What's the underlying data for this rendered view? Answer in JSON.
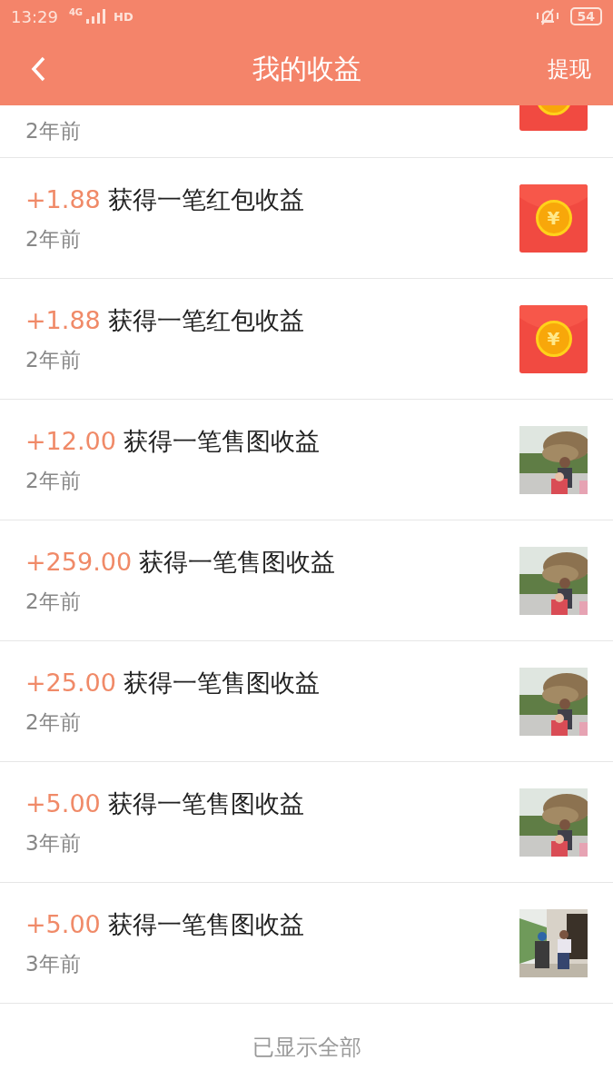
{
  "status_bar": {
    "time": "13:29",
    "network": "4G",
    "hd": "HD",
    "battery": "54"
  },
  "header": {
    "title": "我的收益",
    "action": "提现"
  },
  "items": [
    {
      "kind": "envelope",
      "partial": true,
      "time": "2年前"
    },
    {
      "kind": "envelope",
      "amount": "+1.88",
      "title": "获得一笔红包收益",
      "time": "2年前",
      "coin": "¥"
    },
    {
      "kind": "envelope",
      "amount": "+1.88",
      "title": "获得一笔红包收益",
      "time": "2年前",
      "coin": "¥"
    },
    {
      "amount": "+12.00",
      "title": "获得一笔售图收益",
      "time": "2年前"
    },
    {
      "amount": "+259.00",
      "title": "获得一笔售图收益",
      "time": "2年前"
    },
    {
      "amount": "+25.00",
      "title": "获得一笔售图收益",
      "time": "2年前"
    },
    {
      "amount": "+5.00",
      "title": "获得一笔售图收益",
      "time": "3年前"
    },
    {
      "amount": "+5.00",
      "title": "获得一笔售图收益",
      "time": "3年前"
    }
  ],
  "footer": "已显示全部"
}
